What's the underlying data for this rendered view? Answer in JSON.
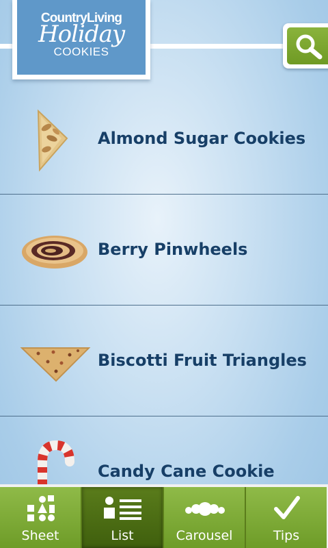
{
  "header": {
    "logo": {
      "brand": "CountryLiving",
      "script": "Holiday",
      "sub": "COOKIES"
    },
    "search_icon": "search-icon"
  },
  "recipes": [
    {
      "label": "Almond Sugar Cookies",
      "thumb": "almond-cookie-thumbnail"
    },
    {
      "label": "Berry Pinwheels",
      "thumb": "pinwheel-cookie-thumbnail"
    },
    {
      "label": "Biscotti Fruit Triangles",
      "thumb": "triangle-cookie-thumbnail"
    },
    {
      "label": "Candy Cane Cookie",
      "thumb": "candy-cane-cookie-thumbnail"
    }
  ],
  "tabs": [
    {
      "label": "Sheet",
      "icon": "shapes-icon"
    },
    {
      "label": "List",
      "icon": "list-icon",
      "selected": true
    },
    {
      "label": "Carousel",
      "icon": "carousel-icon"
    },
    {
      "label": "Tips",
      "icon": "checkmark-icon"
    }
  ],
  "colors": {
    "accent_green": "#7aa82f",
    "active_tab": "#4a6a12",
    "title_text": "#173f67",
    "logo_blue": "#5f98c9"
  }
}
